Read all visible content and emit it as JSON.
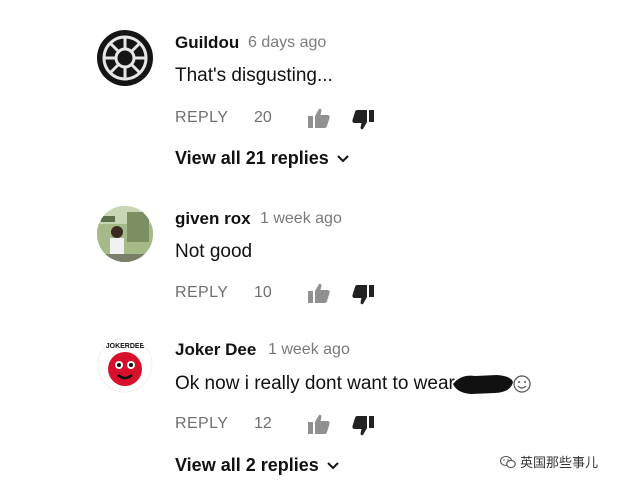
{
  "comments": [
    {
      "author": "Guildou",
      "time": "6 days ago",
      "text": "That's disgusting...",
      "reply_label": "REPLY",
      "likes": "20",
      "view_replies": "View all 21 replies"
    },
    {
      "author": "given rox",
      "time": "1 week ago",
      "text": "Not good",
      "reply_label": "REPLY",
      "likes": "10"
    },
    {
      "author": "Joker Dee",
      "time": "1 week ago",
      "text": "Ok now i really dont want to wear",
      "reply_label": "REPLY",
      "likes": "12",
      "view_replies": "View all 2 replies",
      "avatar_text": "JOKERDEE"
    }
  ],
  "watermark": "英国那些事儿",
  "colors": {
    "meta": "#7a7a7a",
    "icon": "#909090",
    "joker_red": "#d8102b"
  },
  "icons": [
    "empire-emblem-avatar",
    "photo-avatar",
    "joker-avatar",
    "thumbs-up-icon",
    "thumbs-down-icon",
    "chevron-down-icon",
    "smile-emoji-icon",
    "wechat-icon"
  ]
}
